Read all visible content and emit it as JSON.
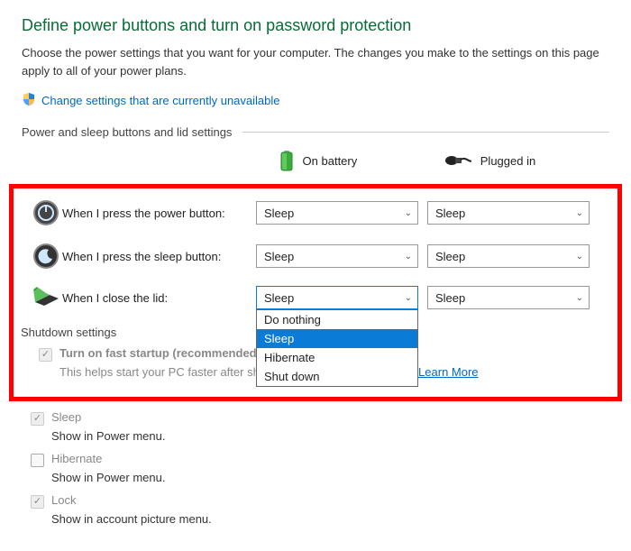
{
  "title": "Define power buttons and turn on password protection",
  "subtitle": "Choose the power settings that you want for your computer. The changes you make to the settings on this page apply to all of your power plans.",
  "changeLink": "Change settings that are currently unavailable",
  "section1": "Power and sleep buttons and lid settings",
  "cols": {
    "battery": "On battery",
    "plugged": "Plugged in"
  },
  "rows": {
    "power": {
      "label": "When I press the power button:",
      "battery": "Sleep",
      "plugged": "Sleep"
    },
    "sleep": {
      "label": "When I press the sleep button:",
      "battery": "Sleep",
      "plugged": "Sleep"
    },
    "lid": {
      "label": "When I close the lid:",
      "battery": "Sleep",
      "plugged": "Sleep"
    }
  },
  "dropdown": {
    "items": [
      "Do nothing",
      "Sleep",
      "Hibernate",
      "Shut down"
    ],
    "selected": "Sleep"
  },
  "shutdownHeader": "Shutdown settings",
  "fastStartup": {
    "label": "Turn on fast startup (recommended)",
    "desc": "This helps start your PC faster after shutdown. Restart isn't affected.",
    "learn": "Learn More"
  },
  "opts": {
    "sleep": {
      "label": "Sleep",
      "desc": "Show in Power menu."
    },
    "hibernate": {
      "label": "Hibernate",
      "desc": "Show in Power menu."
    },
    "lock": {
      "label": "Lock",
      "desc": "Show in account picture menu."
    }
  }
}
